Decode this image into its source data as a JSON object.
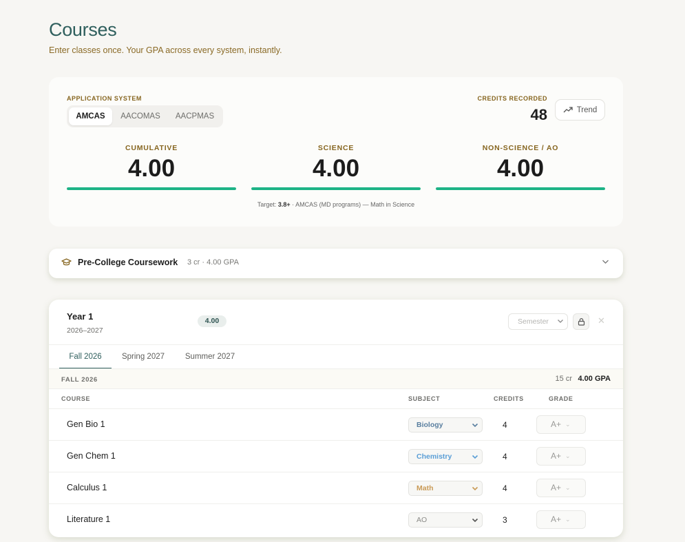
{
  "page": {
    "title": "Courses",
    "subtitle": "Enter classes once. Your GPA across every system, instantly."
  },
  "summary": {
    "system_label": "APPLICATION SYSTEM",
    "systems": [
      "AMCAS",
      "AACOMAS",
      "AACPMAS"
    ],
    "active_system": "AMCAS",
    "credits_label": "CREDITS RECORDED",
    "credits_value": "48",
    "trend_label": "Trend",
    "metrics": [
      {
        "label": "CUMULATIVE",
        "value": "4.00",
        "fill": 1.0
      },
      {
        "label": "SCIENCE",
        "value": "4.00",
        "fill": 1.0
      },
      {
        "label": "NON-SCIENCE / AO",
        "value": "4.00",
        "fill": 1.0
      }
    ],
    "target_prefix": "Target: ",
    "target_value": "3.8+",
    "target_suffix": " · AMCAS (MD programs) — Math in Science"
  },
  "precollege": {
    "title": "Pre-College Coursework",
    "meta": "3 cr · 4.00 GPA"
  },
  "year": {
    "title": "Year 1",
    "range": "2026–2027",
    "gpa": "4.00",
    "semester_placeholder": "Semester",
    "close_symbol": "✕",
    "terms": [
      "Fall 2026",
      "Spring 2027",
      "Summer 2027"
    ],
    "active_term": "Fall 2026",
    "term_header": {
      "name": "FALL 2026",
      "credits": "15 cr",
      "gpa": "4.00 GPA"
    },
    "columns": {
      "course": "COURSE",
      "subject": "SUBJECT",
      "credits": "CREDITS",
      "grade": "GRADE"
    },
    "courses": [
      {
        "name": "Gen Bio 1",
        "subject": "Biology",
        "subject_color": "#5a7fa0",
        "credits": "4",
        "grade": "A+"
      },
      {
        "name": "Gen Chem 1",
        "subject": "Chemistry",
        "subject_color": "#5a9ed6",
        "credits": "4",
        "grade": "A+"
      },
      {
        "name": "Calculus 1",
        "subject": "Math",
        "subject_color": "#c99a56",
        "credits": "4",
        "grade": "A+"
      },
      {
        "name": "Literature 1",
        "subject": "AO",
        "subject_color": "#8a8a87",
        "credits": "3",
        "grade": "A+"
      }
    ]
  },
  "colors": {
    "accent": "#2f5f5d",
    "gold": "#86651f",
    "progress": "#1db386"
  }
}
